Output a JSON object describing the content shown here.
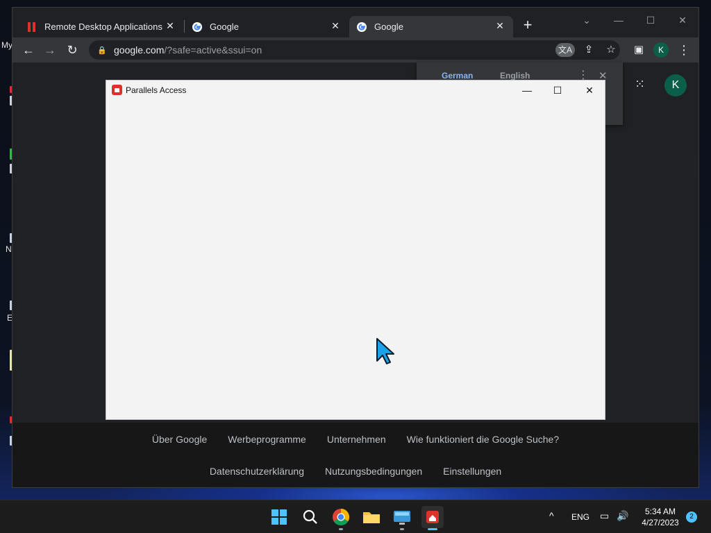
{
  "desktop": {
    "icons": [
      {
        "label": "My"
      },
      {
        "label": ""
      },
      {
        "label": ""
      },
      {
        "label": "N"
      },
      {
        "label": "E"
      },
      {
        "label": ""
      },
      {
        "label": ""
      }
    ]
  },
  "chrome": {
    "tabs": [
      {
        "title": "Remote Desktop Applications–G",
        "close": "✕",
        "favicon": "parallels-icon"
      },
      {
        "title": "Google",
        "close": "✕",
        "favicon": "google-icon"
      },
      {
        "title": "Google",
        "close": "✕",
        "favicon": "google-icon"
      }
    ],
    "new_tab": "+",
    "window_controls": {
      "dropdown": "⌄",
      "minimize": "—",
      "maximize": "☐",
      "close": "✕"
    },
    "toolbar": {
      "back": "←",
      "forward": "→",
      "reload": "↻"
    },
    "address": {
      "host": "google.com",
      "path": "/?safe=active&ssui=on"
    },
    "profile_initial": "K",
    "translate_bubble": {
      "source_lang": "German",
      "target_lang": "English",
      "more": "⋮",
      "close": "✕"
    }
  },
  "google_page": {
    "avatar_initial": "K",
    "footer_row1": [
      "Über Google",
      "Werbeprogramme",
      "Unternehmen",
      "Wie funktioniert die Google Suche?"
    ],
    "footer_row2": [
      "Datenschutzerklärung",
      "Nutzungsbedingungen",
      "Einstellungen"
    ]
  },
  "parallels": {
    "title": "Parallels Access",
    "minimize": "—",
    "maximize": "☐",
    "close": "✕"
  },
  "taskbar": {
    "tray_chevron": "^",
    "language": "ENG",
    "time": "5:34 AM",
    "date": "4/27/2023",
    "notifications": "2"
  },
  "colors": {
    "accent": "#4cc2ff",
    "chrome_dark": "#202124",
    "avatar": "#0b5e4a",
    "parallels_red": "#d9342b"
  }
}
